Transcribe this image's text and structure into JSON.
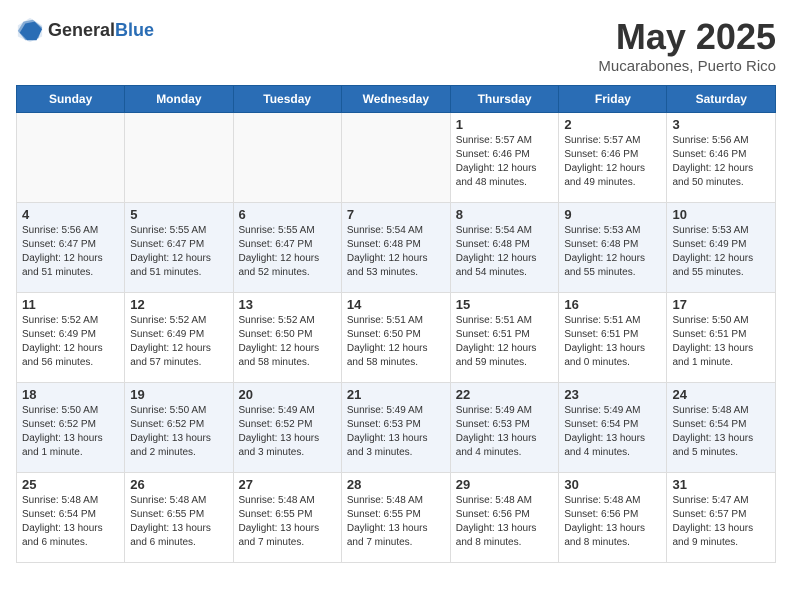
{
  "header": {
    "logo_general": "General",
    "logo_blue": "Blue",
    "title": "May 2025",
    "subtitle": "Mucarabones, Puerto Rico"
  },
  "days_of_week": [
    "Sunday",
    "Monday",
    "Tuesday",
    "Wednesday",
    "Thursday",
    "Friday",
    "Saturday"
  ],
  "weeks": [
    [
      {
        "day": "",
        "info": ""
      },
      {
        "day": "",
        "info": ""
      },
      {
        "day": "",
        "info": ""
      },
      {
        "day": "",
        "info": ""
      },
      {
        "day": "1",
        "info": "Sunrise: 5:57 AM\nSunset: 6:46 PM\nDaylight: 12 hours\nand 48 minutes."
      },
      {
        "day": "2",
        "info": "Sunrise: 5:57 AM\nSunset: 6:46 PM\nDaylight: 12 hours\nand 49 minutes."
      },
      {
        "day": "3",
        "info": "Sunrise: 5:56 AM\nSunset: 6:46 PM\nDaylight: 12 hours\nand 50 minutes."
      }
    ],
    [
      {
        "day": "4",
        "info": "Sunrise: 5:56 AM\nSunset: 6:47 PM\nDaylight: 12 hours\nand 51 minutes."
      },
      {
        "day": "5",
        "info": "Sunrise: 5:55 AM\nSunset: 6:47 PM\nDaylight: 12 hours\nand 51 minutes."
      },
      {
        "day": "6",
        "info": "Sunrise: 5:55 AM\nSunset: 6:47 PM\nDaylight: 12 hours\nand 52 minutes."
      },
      {
        "day": "7",
        "info": "Sunrise: 5:54 AM\nSunset: 6:48 PM\nDaylight: 12 hours\nand 53 minutes."
      },
      {
        "day": "8",
        "info": "Sunrise: 5:54 AM\nSunset: 6:48 PM\nDaylight: 12 hours\nand 54 minutes."
      },
      {
        "day": "9",
        "info": "Sunrise: 5:53 AM\nSunset: 6:48 PM\nDaylight: 12 hours\nand 55 minutes."
      },
      {
        "day": "10",
        "info": "Sunrise: 5:53 AM\nSunset: 6:49 PM\nDaylight: 12 hours\nand 55 minutes."
      }
    ],
    [
      {
        "day": "11",
        "info": "Sunrise: 5:52 AM\nSunset: 6:49 PM\nDaylight: 12 hours\nand 56 minutes."
      },
      {
        "day": "12",
        "info": "Sunrise: 5:52 AM\nSunset: 6:49 PM\nDaylight: 12 hours\nand 57 minutes."
      },
      {
        "day": "13",
        "info": "Sunrise: 5:52 AM\nSunset: 6:50 PM\nDaylight: 12 hours\nand 58 minutes."
      },
      {
        "day": "14",
        "info": "Sunrise: 5:51 AM\nSunset: 6:50 PM\nDaylight: 12 hours\nand 58 minutes."
      },
      {
        "day": "15",
        "info": "Sunrise: 5:51 AM\nSunset: 6:51 PM\nDaylight: 12 hours\nand 59 minutes."
      },
      {
        "day": "16",
        "info": "Sunrise: 5:51 AM\nSunset: 6:51 PM\nDaylight: 13 hours\nand 0 minutes."
      },
      {
        "day": "17",
        "info": "Sunrise: 5:50 AM\nSunset: 6:51 PM\nDaylight: 13 hours\nand 1 minute."
      }
    ],
    [
      {
        "day": "18",
        "info": "Sunrise: 5:50 AM\nSunset: 6:52 PM\nDaylight: 13 hours\nand 1 minute."
      },
      {
        "day": "19",
        "info": "Sunrise: 5:50 AM\nSunset: 6:52 PM\nDaylight: 13 hours\nand 2 minutes."
      },
      {
        "day": "20",
        "info": "Sunrise: 5:49 AM\nSunset: 6:52 PM\nDaylight: 13 hours\nand 3 minutes."
      },
      {
        "day": "21",
        "info": "Sunrise: 5:49 AM\nSunset: 6:53 PM\nDaylight: 13 hours\nand 3 minutes."
      },
      {
        "day": "22",
        "info": "Sunrise: 5:49 AM\nSunset: 6:53 PM\nDaylight: 13 hours\nand 4 minutes."
      },
      {
        "day": "23",
        "info": "Sunrise: 5:49 AM\nSunset: 6:54 PM\nDaylight: 13 hours\nand 4 minutes."
      },
      {
        "day": "24",
        "info": "Sunrise: 5:48 AM\nSunset: 6:54 PM\nDaylight: 13 hours\nand 5 minutes."
      }
    ],
    [
      {
        "day": "25",
        "info": "Sunrise: 5:48 AM\nSunset: 6:54 PM\nDaylight: 13 hours\nand 6 minutes."
      },
      {
        "day": "26",
        "info": "Sunrise: 5:48 AM\nSunset: 6:55 PM\nDaylight: 13 hours\nand 6 minutes."
      },
      {
        "day": "27",
        "info": "Sunrise: 5:48 AM\nSunset: 6:55 PM\nDaylight: 13 hours\nand 7 minutes."
      },
      {
        "day": "28",
        "info": "Sunrise: 5:48 AM\nSunset: 6:55 PM\nDaylight: 13 hours\nand 7 minutes."
      },
      {
        "day": "29",
        "info": "Sunrise: 5:48 AM\nSunset: 6:56 PM\nDaylight: 13 hours\nand 8 minutes."
      },
      {
        "day": "30",
        "info": "Sunrise: 5:48 AM\nSunset: 6:56 PM\nDaylight: 13 hours\nand 8 minutes."
      },
      {
        "day": "31",
        "info": "Sunrise: 5:47 AM\nSunset: 6:57 PM\nDaylight: 13 hours\nand 9 minutes."
      }
    ]
  ]
}
